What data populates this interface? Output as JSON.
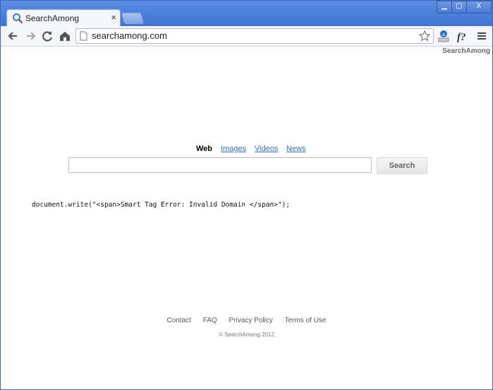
{
  "browser": {
    "tab_title": "SearchAmong",
    "tab_close": "×",
    "url": "searchamong.com",
    "window_controls": {
      "minimize": "▁",
      "maximize": "▢",
      "close": "X"
    }
  },
  "page": {
    "brand": "SearchAmong",
    "search_tabs": {
      "web": "Web",
      "images": "Images",
      "videos": "Videos",
      "news": "News"
    },
    "search_input": {
      "value": "",
      "placeholder": ""
    },
    "search_button": "Search",
    "error_text": "document.write(\"<span>Smart Tag Error: Invalid Domain </span>\");",
    "footer": {
      "contact": "Contact",
      "faq": "FAQ",
      "privacy": "Privacy Policy",
      "terms": "Terms of Use",
      "copyright": "© SearchAmong 2012"
    }
  },
  "icons": {
    "back": "back-arrow-icon",
    "forward": "forward-arrow-icon",
    "reload": "reload-icon",
    "home": "home-icon",
    "page": "page-icon",
    "bookmark": "star-icon",
    "ext1": "extension-icon",
    "ext2": "function-icon",
    "menu": "menu-icon"
  },
  "colors": {
    "frame": "#3f74d2",
    "link": "#3a6fb4"
  }
}
